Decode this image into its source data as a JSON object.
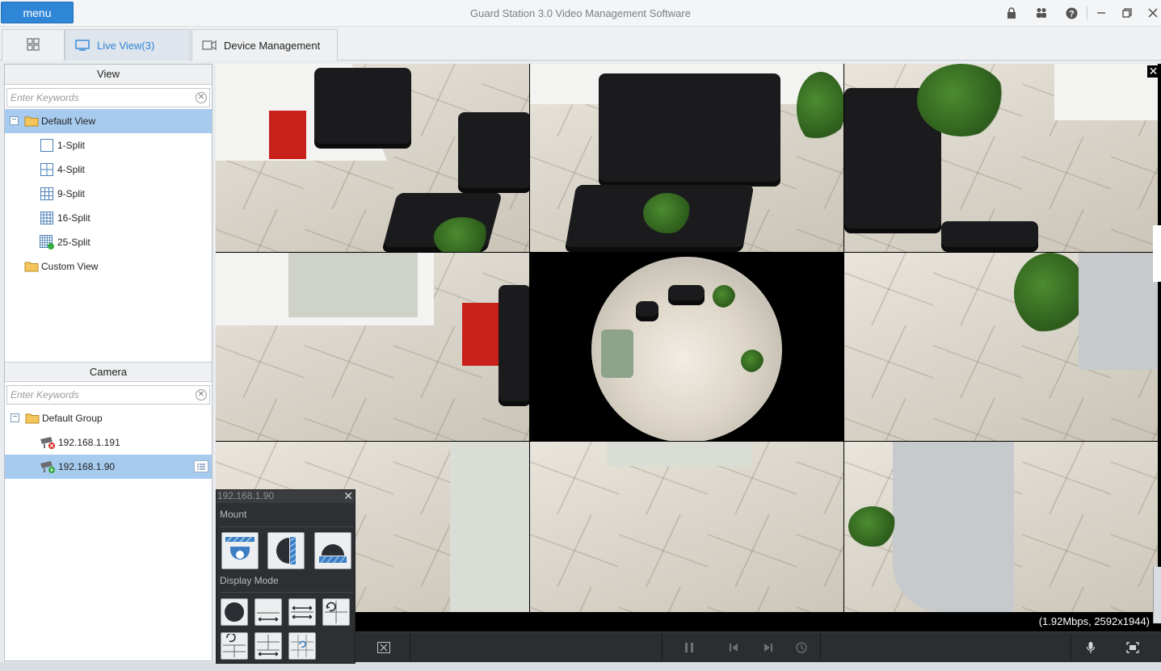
{
  "titlebar": {
    "menu_label": "menu",
    "title": "Guard Station 3.0 Video Management Software",
    "icons": [
      "lock-icon",
      "users-icon",
      "help-icon",
      "minimize-icon",
      "restore-icon",
      "close-icon"
    ]
  },
  "tabs": {
    "home_icon": "grid-icon",
    "live": "Live View(3)",
    "device": "Device Management"
  },
  "view_panel": {
    "header": "View",
    "search_placeholder": "Enter Keywords",
    "default_view": "Default View",
    "splits": [
      "1-Split",
      "4-Split",
      "9-Split",
      "16-Split",
      "25-Split"
    ],
    "custom_view": "Custom View"
  },
  "camera_panel": {
    "header": "Camera",
    "search_placeholder": "Enter Keywords",
    "group": "Default Group",
    "cameras": [
      {
        "ip": "192.168.1.191",
        "status": "offline"
      },
      {
        "ip": "192.168.1.90",
        "status": "online"
      }
    ]
  },
  "video": {
    "stream_info": "(1.92Mbps, 2592x1944)"
  },
  "fisheye_popup": {
    "title": "192.168.1.90",
    "mount_label": "Mount",
    "display_mode_label": "Display Mode",
    "mount_options": [
      "ceiling-mount-icon",
      "wall-mount-icon",
      "desktop-mount-icon"
    ],
    "display_modes": [
      "fisheye-original-icon",
      "panorama-icon",
      "double-panorama-icon",
      "fisheye-quad-icon",
      "fisheye-six-icon",
      "panorama-quad-icon",
      "fisheye-ptz-icon"
    ]
  },
  "colors": {
    "accent": "#2f86d6",
    "selection": "#a7cbee",
    "control_bar": "#2b2d30"
  }
}
